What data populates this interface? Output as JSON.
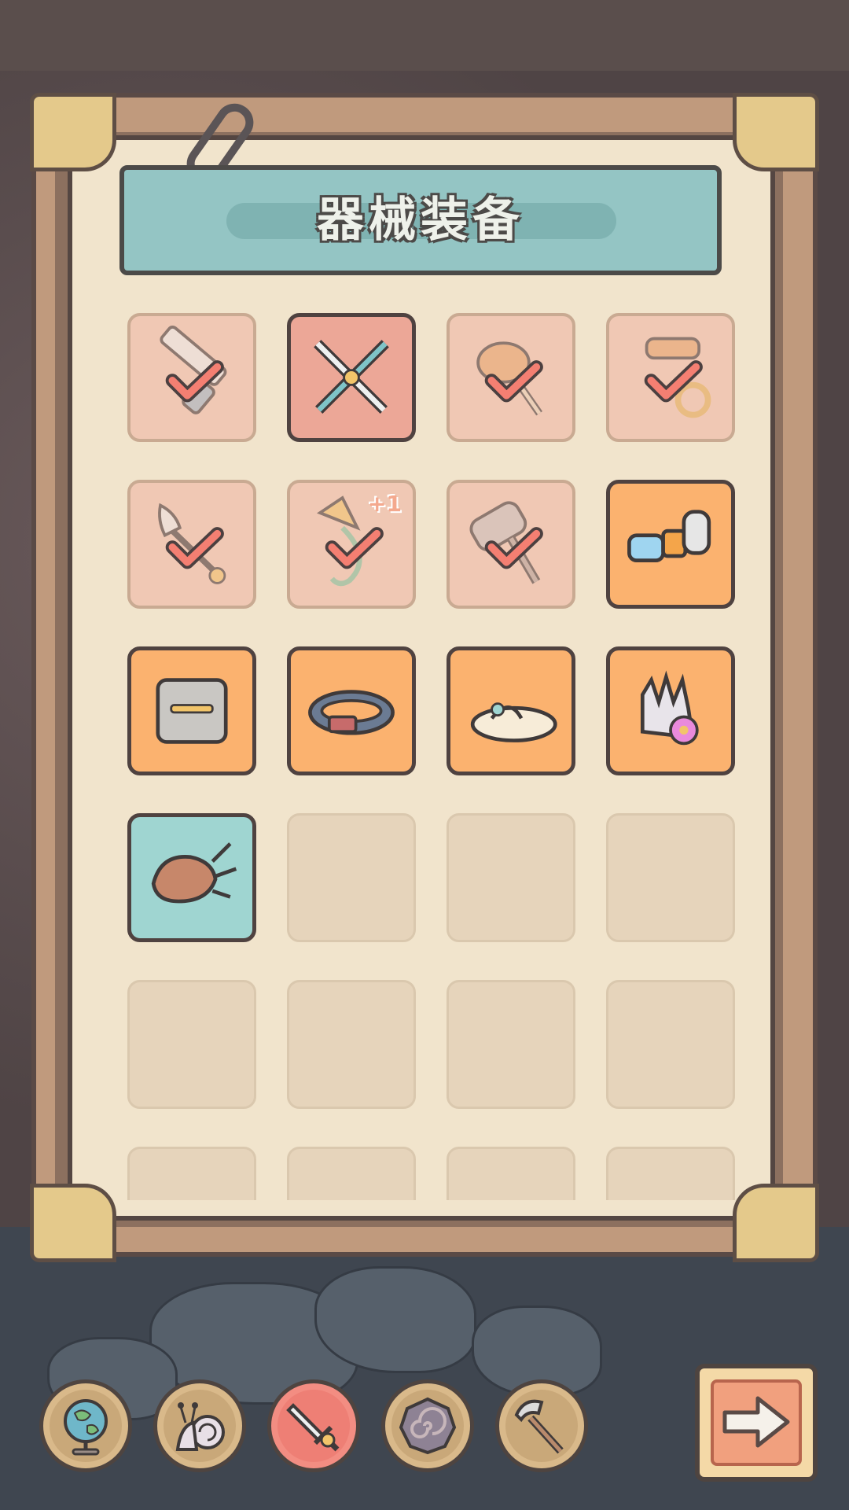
{
  "header": {
    "title": "器械装备"
  },
  "grid": {
    "items": [
      {
        "name": "ruler-weapon",
        "state": "collected",
        "icon": "ruler-icon"
      },
      {
        "name": "crossed-swords",
        "state": "collected-active",
        "icon": "crossed-swords-icon"
      },
      {
        "name": "brain-club",
        "state": "collected",
        "icon": "club-icon"
      },
      {
        "name": "rolling-pin-mace",
        "state": "collected",
        "icon": "mace-icon"
      },
      {
        "name": "rocket-spear",
        "state": "collected",
        "icon": "spear-icon"
      },
      {
        "name": "arrow-hook",
        "state": "collected",
        "icon": "hook-icon",
        "badge": "+1"
      },
      {
        "name": "cage-hammer",
        "state": "collected",
        "icon": "hammer-icon"
      },
      {
        "name": "goggles",
        "state": "unlocked",
        "icon": "goggles-icon"
      },
      {
        "name": "stone-armor",
        "state": "unlocked",
        "icon": "armor-icon"
      },
      {
        "name": "collar-belt",
        "state": "unlocked",
        "icon": "belt-icon"
      },
      {
        "name": "flower-sandal",
        "state": "unlocked",
        "icon": "sandal-icon"
      },
      {
        "name": "flower-glove",
        "state": "unlocked",
        "icon": "glove-icon"
      },
      {
        "name": "claw-gauntlet",
        "state": "special",
        "icon": "claw-icon"
      },
      {
        "state": "empty"
      },
      {
        "state": "empty"
      },
      {
        "state": "empty"
      },
      {
        "state": "empty"
      },
      {
        "state": "empty"
      },
      {
        "state": "empty"
      },
      {
        "state": "empty"
      },
      {
        "state": "empty"
      },
      {
        "state": "empty"
      },
      {
        "state": "empty"
      },
      {
        "state": "empty"
      }
    ]
  },
  "nav": {
    "buttons": [
      {
        "name": "globe",
        "icon": "globe-icon",
        "active": false
      },
      {
        "name": "snail",
        "icon": "snail-icon",
        "active": false
      },
      {
        "name": "weapons",
        "icon": "sword-icon",
        "active": true
      },
      {
        "name": "shield",
        "icon": "spiral-shield-icon",
        "active": false
      },
      {
        "name": "tools",
        "icon": "hammer-icon",
        "active": false
      }
    ],
    "next": {
      "icon": "arrow-right-icon"
    }
  },
  "colors": {
    "collected": "#f0c8b4",
    "unlocked": "#fbb26f",
    "special": "#9fd5d1",
    "check": "#f47f72"
  }
}
